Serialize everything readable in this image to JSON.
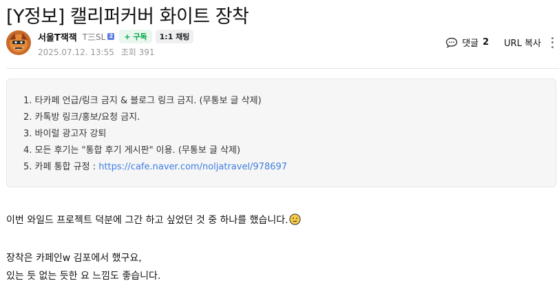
{
  "post": {
    "title": "[Y정보] 캘리퍼커버 화이트 장착",
    "author": {
      "nickname": "서울T잭잭",
      "level": "T三SL",
      "level_badge": "2",
      "subscribe_label": "+ 구독",
      "chat_label": "1:1 채팅"
    },
    "date": "2025.07.12. 13:55",
    "views_label": "조회 391",
    "comments_label": "댓글",
    "comments_count": "2",
    "url_copy_label": "URL 복사"
  },
  "notice": {
    "items": [
      "1. 타카페 언급/링크 금지 & 블로그 링크 금지. (무통보 글 삭제)",
      "2. 카톡방 링크/홍보/요청 금지.",
      "3. 바이럴 광고자 강퇴",
      "4. 모든 후기는 \"통합 후기 게시판\" 이용. (무통보 글 삭제)"
    ],
    "rules_label": "5. 카페 통합 규정 : ",
    "rules_link": "https://cafe.naver.com/noljatravel/978697"
  },
  "body": {
    "line1": "이번 와일드 프로젝트 덕분에 그간 하고 싶었던 것 중 하나를 했습니다.",
    "line2": "장착은 카페인w 김포에서 했구요,",
    "line3": "있는 듯 없는 듯한 요 느낌도 좋습니다."
  },
  "colors": {
    "accent_green": "#03a74a",
    "link_blue": "#3d7ee0",
    "notice_bg": "#f6f6f6"
  },
  "icons": [
    "avatar-image",
    "level-badge-icon",
    "comment-icon",
    "more-vertical-icon",
    "smile-emoji-icon"
  ]
}
